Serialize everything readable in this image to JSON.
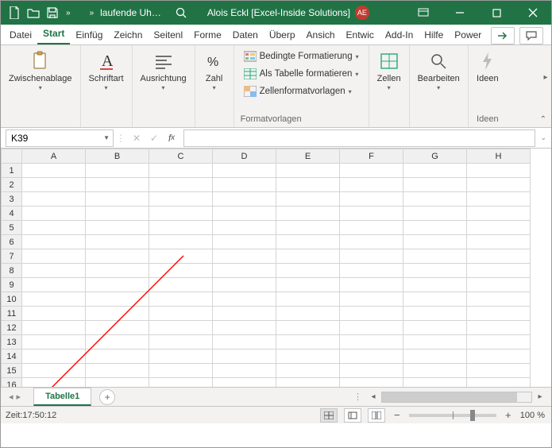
{
  "titlebar": {
    "doc_name": "laufende Uh…",
    "user_name": "Alois Eckl [Excel-Inside Solutions]",
    "user_initials": "AE"
  },
  "tabs": {
    "file": "Datei",
    "items": [
      "Start",
      "Einfüg",
      "Zeichn",
      "Seitenl",
      "Forme",
      "Daten",
      "Überp",
      "Ansich",
      "Entwic",
      "Add-In",
      "Hilfe",
      "Power"
    ],
    "active_index": 0
  },
  "ribbon": {
    "clipboard": {
      "label": "Zwischenablage"
    },
    "font": {
      "label": "Schriftart"
    },
    "alignment": {
      "label": "Ausrichtung"
    },
    "number": {
      "label": "Zahl"
    },
    "styles": {
      "label": "Formatvorlagen",
      "cond_fmt": "Bedingte Formatierung",
      "as_table": "Als Tabelle formatieren",
      "cell_styles": "Zellenformatvorlagen"
    },
    "cells": {
      "label": "Zellen"
    },
    "editing": {
      "label": "Bearbeiten"
    },
    "ideas": {
      "label": "Ideen"
    }
  },
  "formula_bar": {
    "namebox": "K39",
    "formula": ""
  },
  "grid": {
    "columns": [
      "A",
      "B",
      "C",
      "D",
      "E",
      "F",
      "G",
      "H"
    ],
    "rows": [
      "1",
      "2",
      "3",
      "4",
      "5",
      "6",
      "7",
      "8",
      "9",
      "10",
      "11",
      "12",
      "13",
      "14",
      "15",
      "16"
    ]
  },
  "sheets": {
    "active": "Tabelle1"
  },
  "status": {
    "left_text": "Zeit:17:50:12",
    "zoom": "100 %"
  }
}
